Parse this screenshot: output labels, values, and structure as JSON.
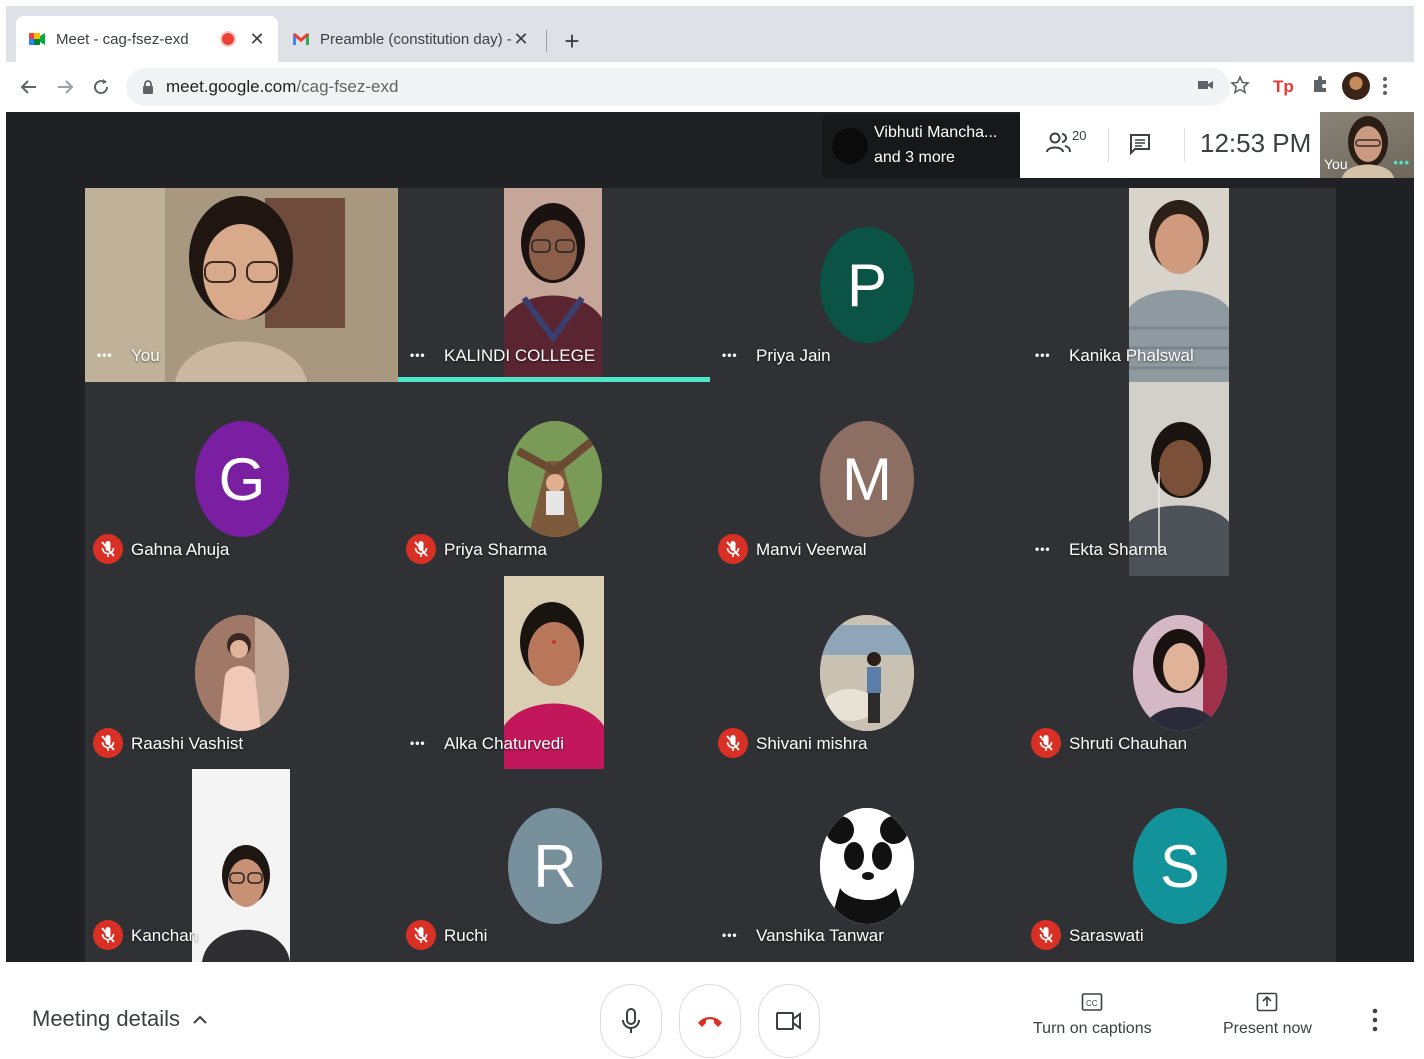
{
  "browser": {
    "tabs": [
      {
        "title": "Meet - cag-fsez-exd",
        "recording": true
      },
      {
        "title": "Preamble (constitution day) - ∨"
      }
    ],
    "url_host": "meet.google.com",
    "url_path": "/cag-fsez-exd"
  },
  "meet": {
    "presenter_line1": "Vibhuti Mancha...",
    "presenter_line2": "and 3 more",
    "people_count": "20",
    "clock": "12:53 PM",
    "self_label": "You",
    "participants": [
      {
        "name": "You",
        "status": "dots"
      },
      {
        "name": "KALINDI COLLEGE",
        "status": "dots",
        "speaking": true
      },
      {
        "name": "Priya Jain",
        "status": "dots",
        "initial": "P",
        "color": "#0b5345"
      },
      {
        "name": "Kanika Phalswal",
        "status": "dots"
      },
      {
        "name": "Gahna Ahuja",
        "status": "muted",
        "initial": "G",
        "color": "#7b1fa2"
      },
      {
        "name": "Priya Sharma",
        "status": "muted"
      },
      {
        "name": "Manvi Veerwal",
        "status": "muted",
        "initial": "M",
        "color": "#8d6e63"
      },
      {
        "name": "Ekta Sharma",
        "status": "dots"
      },
      {
        "name": "Raashi Vashist",
        "status": "muted"
      },
      {
        "name": "Alka Chaturvedi",
        "status": "dots"
      },
      {
        "name": "Shivani mishra",
        "status": "muted"
      },
      {
        "name": "Shruti Chauhan",
        "status": "muted"
      },
      {
        "name": "Kanchan",
        "status": "muted"
      },
      {
        "name": "Ruchi",
        "status": "muted",
        "initial": "R",
        "color": "#78909c"
      },
      {
        "name": "Vanshika Tanwar",
        "status": "dots"
      },
      {
        "name": "Saraswati",
        "status": "muted",
        "initial": "S",
        "color": "#12939a"
      }
    ]
  },
  "bottom": {
    "meeting_details": "Meeting details",
    "captions": "Turn on captions",
    "present": "Present now"
  },
  "colors": {
    "stage": "#202124",
    "speaking": "#4fe6c8",
    "mute": "#d93025",
    "hangup": "#d93025"
  }
}
